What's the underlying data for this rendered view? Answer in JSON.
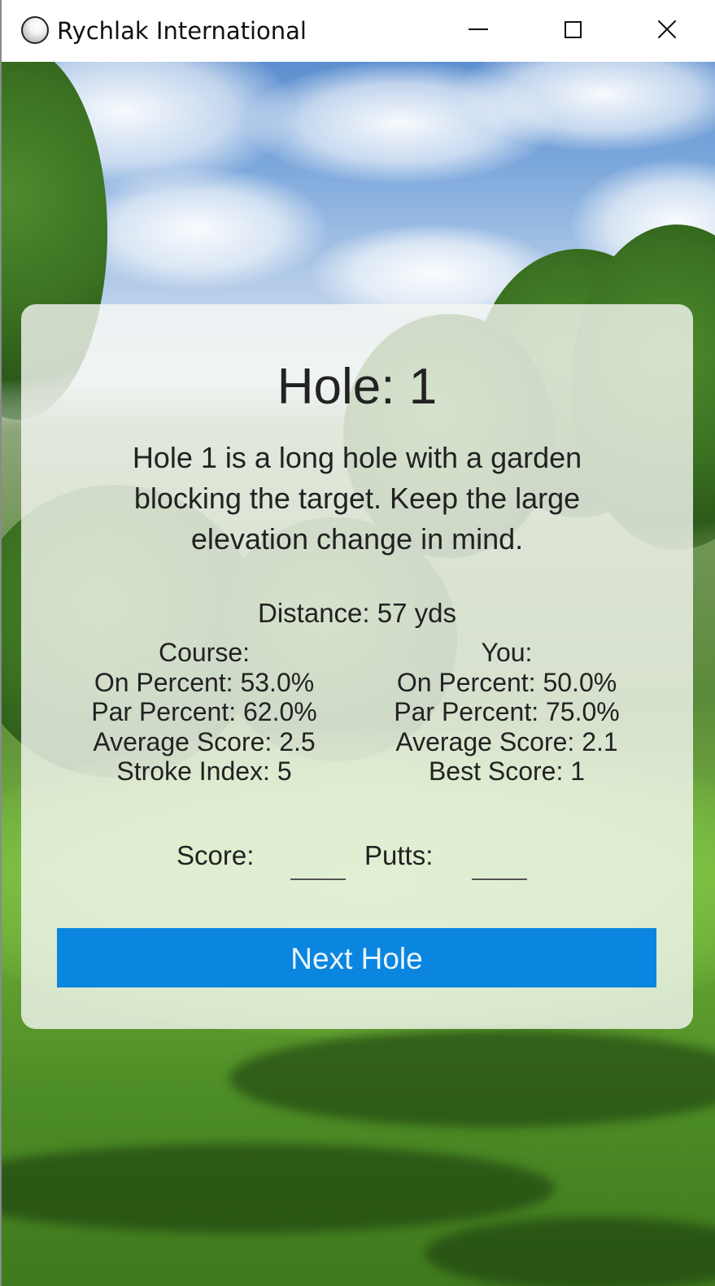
{
  "window": {
    "title": "Rychlak International",
    "icon": "golf-ball-icon",
    "controls": [
      "minimize-icon",
      "maximize-icon",
      "close-icon"
    ]
  },
  "hole": {
    "title": "Hole: 1",
    "description": "Hole 1 is a long hole with a garden blocking the target. Keep the large elevation change in mind.",
    "distance": "Distance: 57 yds"
  },
  "course_stats": {
    "heading": "Course:",
    "on_percent": "On Percent: 53.0%",
    "par_percent": "Par Percent: 62.0%",
    "average_score": "Average Score: 2.5",
    "stroke_index": "Stroke Index: 5"
  },
  "you_stats": {
    "heading": "You:",
    "on_percent": "On Percent: 50.0%",
    "par_percent": "Par Percent: 75.0%",
    "average_score": "Average Score: 2.1",
    "best_score": "Best Score: 1"
  },
  "entry": {
    "score_label": "Score:",
    "score_value": "",
    "putts_label": "Putts:",
    "putts_value": ""
  },
  "actions": {
    "next_label": "Next Hole"
  },
  "colors": {
    "accent": "#0a86e0",
    "card": "#f6f8f4"
  }
}
